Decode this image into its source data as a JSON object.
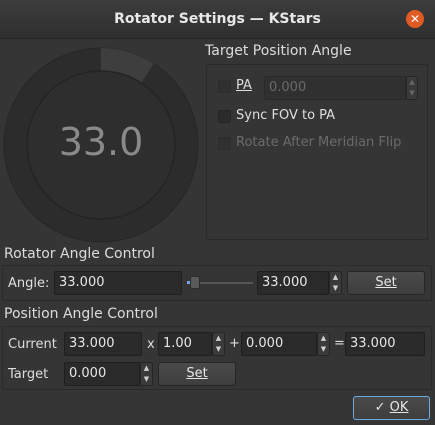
{
  "window": {
    "title": "Rotator Settings — KStars",
    "close_icon": "close-icon"
  },
  "gauge": {
    "value": "33.0",
    "angle_fraction": 0.0917
  },
  "target_position_angle": {
    "title": "Target Position Angle",
    "pa_label": "PA",
    "pa_value": "0.000",
    "sync_fov_label": "Sync FOV to PA",
    "rotate_after_flip_label": "Rotate After Meridian Flip"
  },
  "rotator_angle_control": {
    "title": "Rotator Angle Control",
    "angle_label": "Angle:",
    "angle_value": "33.000",
    "slider_fraction": 0.09,
    "spin_value": "33.000",
    "set_label": "Set"
  },
  "position_angle_control": {
    "title": "Position Angle Control",
    "current_label": "Current",
    "current_value": "33.000",
    "x_label": "x",
    "multiplier_value": "1.00",
    "plus_label": "+",
    "offset_value": "0.000",
    "equals_label": "=",
    "result_value": "33.000",
    "target_label": "Target",
    "target_value": "0.000",
    "set_label": "Set"
  },
  "footer": {
    "ok_label": "OK"
  },
  "colors": {
    "accent_ok": "#6fa8dc",
    "close_red": "#e05a24"
  }
}
